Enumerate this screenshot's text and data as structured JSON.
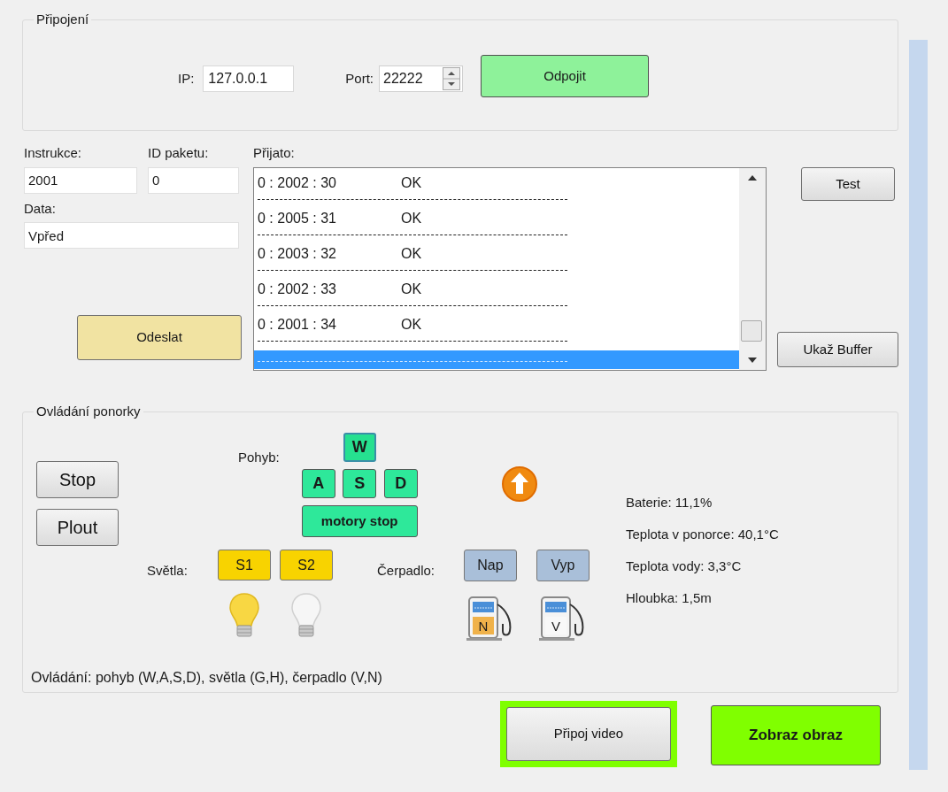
{
  "connection": {
    "title": "Připojení",
    "ip_label": "IP:",
    "ip": "127.0.0.1",
    "port_label": "Port:",
    "port": "22222",
    "disconnect": "Odpojit"
  },
  "send": {
    "instruction_label": "Instrukce:",
    "instruction": "2001",
    "packet_label": "ID paketu:",
    "packet": "0",
    "data_label": "Data:",
    "data": "Vpřed",
    "send_button": "Odeslat"
  },
  "received": {
    "label": "Přijato:",
    "rows": [
      {
        "code": "0 : 2002 : 30",
        "status": "OK",
        "selected": false
      },
      {
        "code": "0 : 2005 : 31",
        "status": "OK",
        "selected": false
      },
      {
        "code": "0 : 2003 : 32",
        "status": "OK",
        "selected": false
      },
      {
        "code": "0 : 2002 : 33",
        "status": "OK",
        "selected": false
      },
      {
        "code": "0 : 2001 : 34",
        "status": "OK",
        "selected": false
      },
      {
        "selected": true
      }
    ]
  },
  "side_buttons": [
    "Test",
    "Ukaž Buffer"
  ],
  "control": {
    "title": "Ovládání ponorky",
    "buttons": [
      "Stop",
      "Plout"
    ],
    "movement_label": "Pohyb:",
    "keys": [
      {
        "label": "W",
        "selected": true
      },
      {
        "label": "A",
        "selected": false
      },
      {
        "label": "S",
        "selected": false
      },
      {
        "label": "D",
        "selected": false
      }
    ],
    "motor_stop": "motory stop",
    "lights_label": "Světla:",
    "lights": [
      {
        "label": "S1",
        "on": true
      },
      {
        "label": "S2",
        "on": false
      }
    ],
    "pump_label": "Čerpadlo:",
    "pumps": [
      {
        "label": "Nap",
        "mark": "N",
        "active": true
      },
      {
        "label": "Vyp",
        "mark": "V",
        "active": false
      }
    ],
    "readings": [
      "Baterie: 11,1%",
      "Teplota v ponorce: 40,1°C",
      "Teplota vody: 3,3°C",
      "Hloubka: 1,5m"
    ],
    "hint": "Ovládání: pohyb (W,A,S,D), světla (G,H), čerpadlo (V,N)"
  },
  "bottom_buttons": [
    {
      "label": "Připoj video",
      "kind": "framed"
    },
    {
      "label": "Zobraz obraz",
      "kind": "accent"
    }
  ]
}
